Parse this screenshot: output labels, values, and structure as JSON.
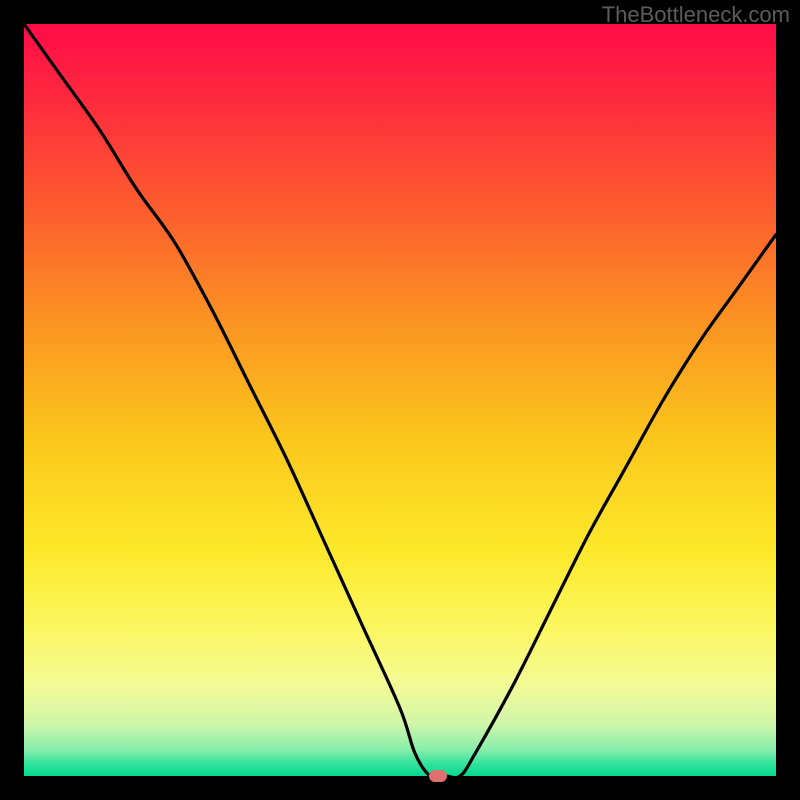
{
  "watermark": "TheBottleneck.com",
  "chart_data": {
    "type": "line",
    "title": "",
    "xlabel": "",
    "ylabel": "",
    "xlim": [
      0,
      100
    ],
    "ylim": [
      0,
      100
    ],
    "series": [
      {
        "name": "bottleneck-curve",
        "x": [
          0,
          5,
          10,
          15,
          20,
          25,
          30,
          35,
          40,
          45,
          50,
          52,
          54,
          56,
          58,
          60,
          65,
          70,
          75,
          80,
          85,
          90,
          95,
          100
        ],
        "y": [
          100,
          93,
          86,
          78,
          71,
          62,
          52,
          42,
          31,
          20,
          9,
          3,
          0,
          0,
          0,
          3,
          12,
          22,
          32,
          41,
          50,
          58,
          65,
          72
        ]
      }
    ],
    "gradient_stops": [
      {
        "offset": 0.0,
        "color": "#ff0b48"
      },
      {
        "offset": 0.1,
        "color": "#ff2a3e"
      },
      {
        "offset": 0.25,
        "color": "#fd5e2e"
      },
      {
        "offset": 0.4,
        "color": "#fb9522"
      },
      {
        "offset": 0.55,
        "color": "#fbc61c"
      },
      {
        "offset": 0.7,
        "color": "#fde92a"
      },
      {
        "offset": 0.8,
        "color": "#fcf75f"
      },
      {
        "offset": 0.88,
        "color": "#f3fb96"
      },
      {
        "offset": 0.93,
        "color": "#d1f6a9"
      },
      {
        "offset": 0.965,
        "color": "#88eeab"
      },
      {
        "offset": 0.985,
        "color": "#2de29b"
      },
      {
        "offset": 1.0,
        "color": "#05d98d"
      }
    ],
    "marker": {
      "x": 55,
      "y": 0,
      "color": "#e07070"
    }
  }
}
